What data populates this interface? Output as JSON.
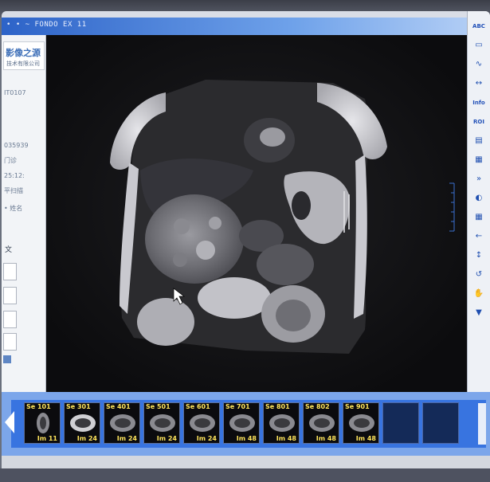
{
  "window": {
    "title": "• • ~ FONDO EX 11"
  },
  "left_panel": {
    "logo_main": "影像之源",
    "logo_sub": "技术有限公司",
    "lines": [
      {
        "text": "IT0107"
      },
      {
        "text": "035939"
      },
      {
        "text": "门诊"
      },
      {
        "text": "25:12:"
      },
      {
        "text": "平扫描"
      },
      {
        "text": "• 姓名"
      },
      {
        "text": "文"
      }
    ]
  },
  "toolbar": {
    "items": [
      {
        "name": "text-annotation-tool",
        "label": "ABC",
        "kind": "text"
      },
      {
        "name": "rectangle-tool",
        "label": "▭",
        "kind": "glyph"
      },
      {
        "name": "freehand-tool",
        "label": "∿",
        "kind": "glyph"
      },
      {
        "name": "measure-tool",
        "label": "↔",
        "kind": "glyph"
      },
      {
        "name": "info-tool",
        "label": "Info",
        "kind": "text"
      },
      {
        "name": "roi-tool",
        "label": "ROI",
        "kind": "text"
      },
      {
        "name": "overlay-tool",
        "label": "▤",
        "kind": "glyph"
      },
      {
        "name": "layout-tool",
        "label": "▦",
        "kind": "glyph"
      },
      {
        "name": "invert-tool",
        "label": "»",
        "kind": "glyph"
      },
      {
        "name": "window-level-tool",
        "label": "◐",
        "kind": "glyph"
      },
      {
        "name": "grid-tool",
        "label": "▦",
        "kind": "glyph"
      },
      {
        "name": "prev-tool",
        "label": "←",
        "kind": "glyph"
      },
      {
        "name": "scroll-tool",
        "label": "↕",
        "kind": "glyph"
      },
      {
        "name": "rotate-tool",
        "label": "↺",
        "kind": "glyph"
      },
      {
        "name": "pan-tool",
        "label": "✋",
        "kind": "glyph"
      },
      {
        "name": "more-tool",
        "label": "▼",
        "kind": "glyph"
      }
    ]
  },
  "series_strip": {
    "thumbs": [
      {
        "series": "Se 101",
        "image": "Im 11"
      },
      {
        "series": "Se 301",
        "image": "Im 24"
      },
      {
        "series": "Se 401",
        "image": "Im 24"
      },
      {
        "series": "Se 501",
        "image": "Im 24"
      },
      {
        "series": "Se 601",
        "image": "Im 24"
      },
      {
        "series": "Se 701",
        "image": "Im 48"
      },
      {
        "series": "Se 801",
        "image": "Im 48"
      },
      {
        "series": "Se 802",
        "image": "Im 48"
      },
      {
        "series": "Se 901",
        "image": "Im 48"
      }
    ]
  }
}
